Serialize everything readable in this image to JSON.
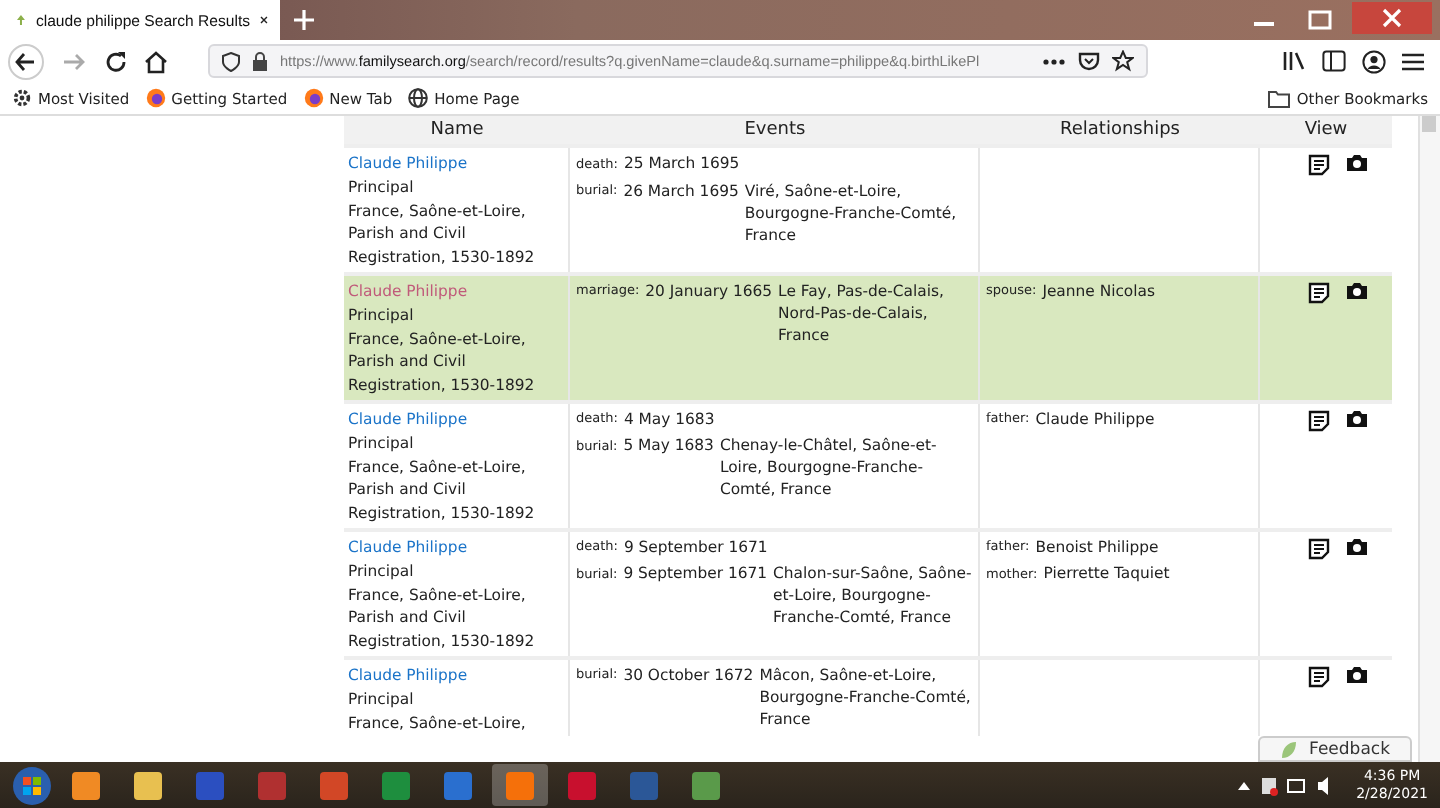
{
  "browser": {
    "tab_title": "claude philippe Search Results",
    "url": {
      "scheme": "https://www.",
      "domain": "familysearch.org",
      "path": "/search/record/results?q.givenName=claude&q.surname=philippe&q.birthLikePl"
    },
    "bookmarks": [
      "Most Visited",
      "Getting Started",
      "New Tab",
      "Home Page"
    ],
    "other_bookmarks": "Other Bookmarks"
  },
  "table": {
    "columns": [
      "Name",
      "Events",
      "Relationships",
      "View"
    ],
    "rows": [
      {
        "selected": false,
        "name": "Claude Philippe",
        "role": "Principal",
        "collection": [
          "France, Saône-et-Loire,",
          "Parish and Civil",
          "Registration, 1530-1892"
        ],
        "events": [
          {
            "type": "death:",
            "date": "25 March 1695"
          },
          {
            "type": "burial:",
            "date": "26 March 1695",
            "place": "Viré, Saône-et-Loire, Bourgogne-Franche-Comté, France"
          }
        ],
        "relationships": []
      },
      {
        "selected": true,
        "name": "Claude Philippe",
        "role": "Principal",
        "collection": [
          "France, Saône-et-Loire,",
          "Parish and Civil",
          "Registration, 1530-1892"
        ],
        "events": [
          {
            "type": "marriage:",
            "date": "20 January 1665",
            "place": "Le Fay, Pas-de-Calais, Nord-Pas-de-Calais, France"
          }
        ],
        "relationships": [
          {
            "role": "spouse:",
            "name": "Jeanne Nicolas"
          }
        ]
      },
      {
        "selected": false,
        "name": "Claude Philippe",
        "role": "Principal",
        "collection": [
          "France, Saône-et-Loire,",
          "Parish and Civil",
          "Registration, 1530-1892"
        ],
        "events": [
          {
            "type": "death:",
            "date": "4 May 1683"
          },
          {
            "type": "burial:",
            "date": "5 May 1683",
            "place": "Chenay-le-Châtel, Saône-et-Loire, Bourgogne-Franche-Comté, France"
          }
        ],
        "relationships": [
          {
            "role": "father:",
            "name": "Claude Philippe"
          }
        ]
      },
      {
        "selected": false,
        "name": "Claude Philippe",
        "role": "Principal",
        "collection": [
          "France, Saône-et-Loire,",
          "Parish and Civil",
          "Registration, 1530-1892"
        ],
        "events": [
          {
            "type": "death:",
            "date": "9 September 1671"
          },
          {
            "type": "burial:",
            "date": "9 September 1671",
            "place": "Chalon-sur-Saône, Saône-et-Loire, Bourgogne-Franche-Comté, France"
          }
        ],
        "relationships": [
          {
            "role": "father:",
            "name": "Benoist Philippe"
          },
          {
            "role": "mother:",
            "name": "Pierrette Taquiet"
          }
        ]
      },
      {
        "selected": false,
        "name": "Claude Philippe",
        "role": "Principal",
        "collection": [
          "France, Saône-et-Loire,"
        ],
        "events": [
          {
            "type": "burial:",
            "date": "30 October 1672",
            "place": "Mâcon, Saône-et-Loire, Bourgogne-Franche-Comté, France"
          }
        ],
        "relationships": []
      }
    ]
  },
  "feedback": "Feedback",
  "taskbar": {
    "time": "4:36 PM",
    "date": "2/28/2021"
  }
}
